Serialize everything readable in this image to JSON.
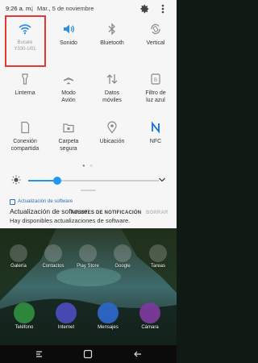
{
  "status_bar": {
    "time": "9:26 a. m.",
    "separator": "|",
    "date": "Mar., 5 de noviembre"
  },
  "tiles": [
    {
      "label": "Bucare\nY330-U01",
      "icon": "wifi-icon",
      "active": true,
      "dim": true
    },
    {
      "label": "Sonido",
      "icon": "volume-icon",
      "active": true
    },
    {
      "label": "Bluetooth",
      "icon": "bluetooth-icon",
      "active": false
    },
    {
      "label": "Vertical",
      "icon": "rotate-icon",
      "active": false
    },
    {
      "label": "Linterna",
      "icon": "flashlight-icon",
      "active": false
    },
    {
      "label": "Modo\nAvión",
      "icon": "airplane-icon",
      "active": false
    },
    {
      "label": "Datos\nmóviles",
      "icon": "mobile-data-icon",
      "active": false
    },
    {
      "label": "Filtro de\nluz azul",
      "icon": "blue-light-filter-icon",
      "active": false
    },
    {
      "label": "Conexión\ncompartida",
      "icon": "hotspot-icon",
      "active": false
    },
    {
      "label": "Carpeta\nsegura",
      "icon": "secure-folder-icon",
      "active": false
    },
    {
      "label": "Ubicación",
      "icon": "location-icon",
      "active": false
    },
    {
      "label": "NFC",
      "icon": "nfc-icon",
      "active": true
    }
  ],
  "pager": "● ○",
  "brightness": {
    "level": 0.22
  },
  "notification": {
    "app": "Actualización de software",
    "title": "Actualización de software",
    "text": "Hay disponibles actualizaciones de software."
  },
  "actions": {
    "settings": "AJUSTES DE NOTIFICACIÓN",
    "clear": "BORRAR"
  },
  "home_apps_row1": [
    "Galería",
    "Contactos",
    "Play Store",
    "Google",
    "Tareas"
  ],
  "home_apps_row2": [
    "Teléfono",
    "Internet",
    "Mensajes",
    "Cámara"
  ],
  "colors": {
    "accent": "#2196f3",
    "highlight": "#e53935",
    "panel": "#f6f6f6"
  }
}
